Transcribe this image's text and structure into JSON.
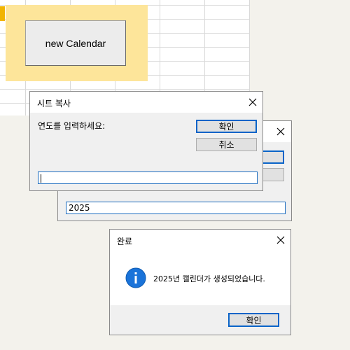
{
  "sheet": {
    "button_label": "new Calendar"
  },
  "dialog_back": {
    "field_value": "2025"
  },
  "dialog_copy": {
    "title": "시트 복사",
    "prompt": "연도를 입력하세요:",
    "ok_label": "확인",
    "cancel_label": "취소",
    "field_value": ""
  },
  "dialog_done": {
    "title": "완료",
    "message": "2025년 캘린더가 생성되었습니다.",
    "ok_label": "확인",
    "info_icon": "info-icon"
  },
  "colors": {
    "accent": "#0a64c8",
    "highlight": "#fde59a",
    "sheet_marker": "#f1b400",
    "info_icon": "#1a73d9"
  }
}
